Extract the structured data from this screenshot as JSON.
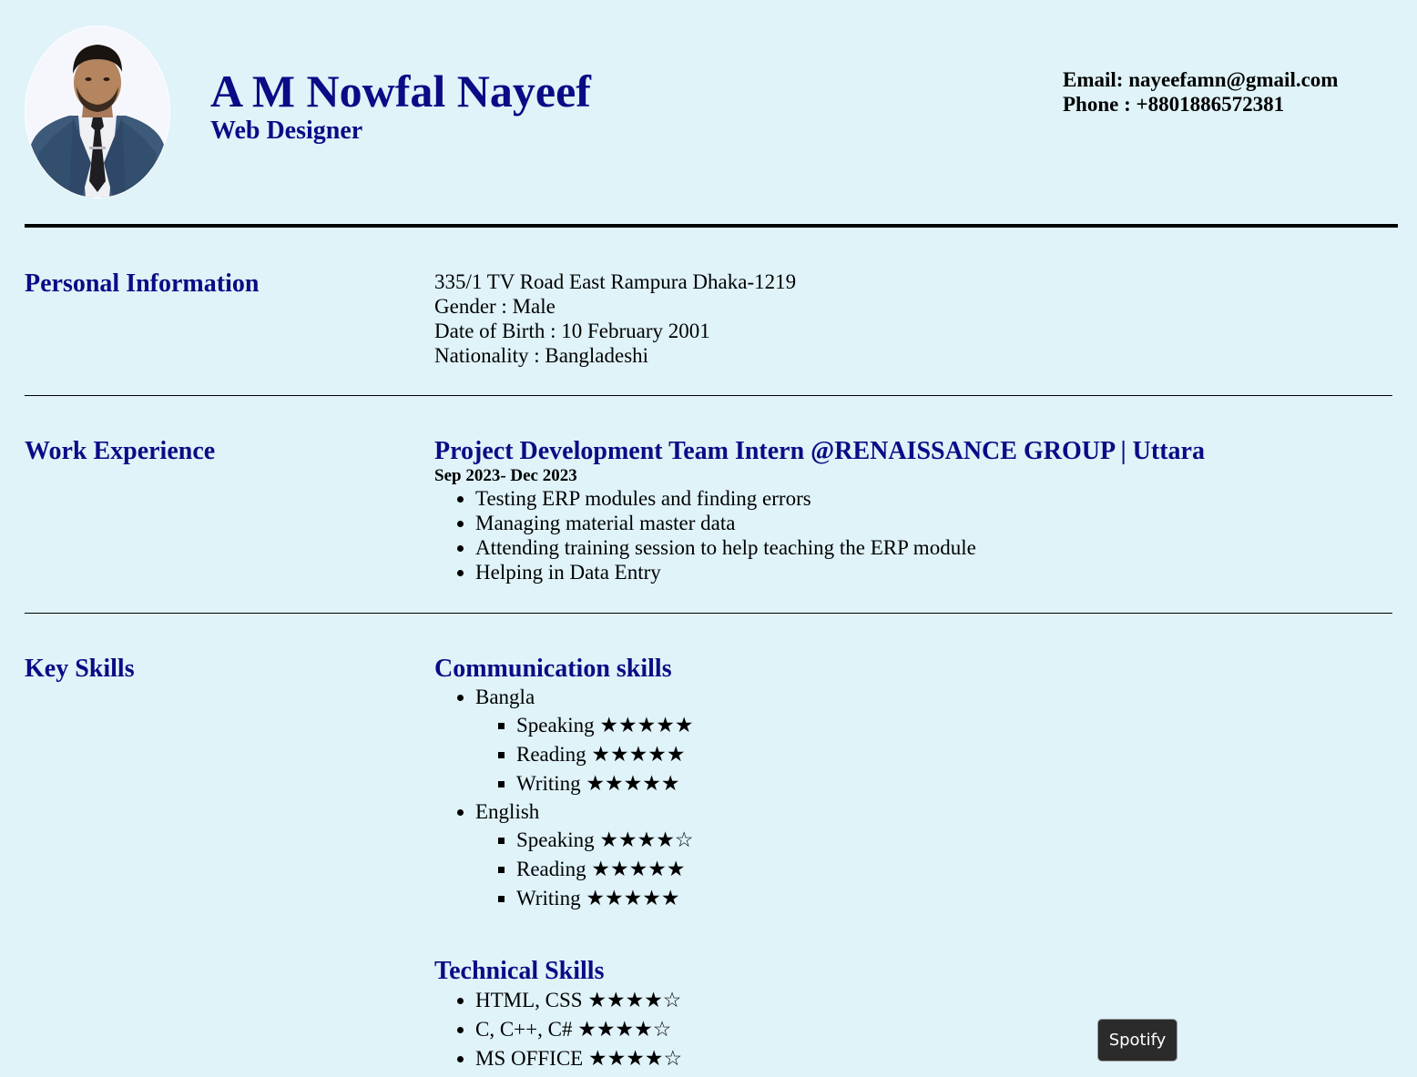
{
  "header": {
    "name": "A M Nowfal Nayeef",
    "role": "Web Designer",
    "email": "Email: nayeefamn@gmail.com",
    "phone": "Phone : +8801886572381"
  },
  "personal": {
    "title": "Personal Information",
    "lines": [
      "335/1 TV Road East Rampura Dhaka-1219",
      "Gender : Male",
      "Date of Birth : 10 February 2001",
      "Nationality : Bangladeshi"
    ]
  },
  "work": {
    "title": "Work Experience",
    "position": "Project Development Team Intern @RENAISSANCE GROUP | Uttara",
    "dates": "Sep 2023- Dec 2023",
    "items": [
      "Testing ERP modules and finding errors",
      "Managing material master data",
      "Attending training session to help teaching the ERP module",
      "Helping in Data Entry"
    ]
  },
  "skills": {
    "title": "Key Skills",
    "communication": {
      "title": "Communication skills",
      "languages": [
        {
          "name": "Bangla",
          "items": [
            "Speaking ★★★★★",
            "Reading ★★★★★",
            "Writing ★★★★★"
          ]
        },
        {
          "name": "English",
          "items": [
            "Speaking ★★★★☆",
            "Reading ★★★★★",
            "Writing ★★★★★"
          ]
        }
      ]
    },
    "technical": {
      "title": "Technical Skills",
      "items": [
        "HTML, CSS ★★★★☆",
        "C, C++, C# ★★★★☆",
        "MS OFFICE ★★★★☆"
      ]
    }
  },
  "overlay": {
    "spotify_label": "Spotify"
  },
  "colors": {
    "background": "#dff3f9",
    "heading": "#0b0b86",
    "text": "#000000",
    "button_bg": "#2b2b2b"
  }
}
